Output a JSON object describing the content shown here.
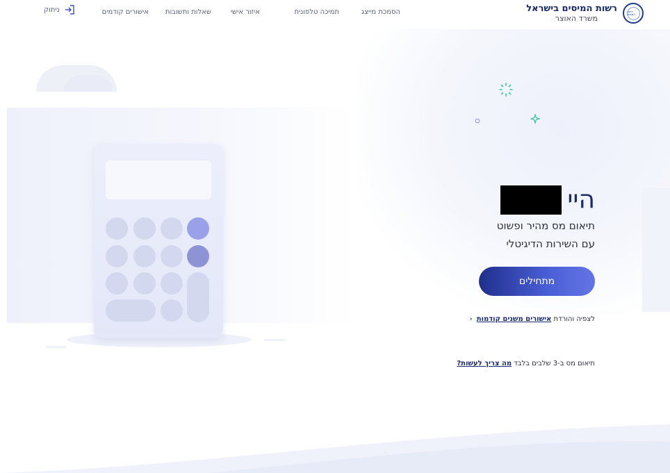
{
  "header": {
    "brand_title": "רשות המיסים בישראל",
    "brand_subtitle": "משרד האוצר",
    "logo_text": "רשות המסים",
    "nav": [
      {
        "label": "הסמכת מייצג"
      },
      {
        "label": "תמיכה טלפונית"
      },
      {
        "label": "איזור אישי"
      },
      {
        "label": "שאלות ותשובות"
      },
      {
        "label": "אישורים קודמים"
      }
    ],
    "logout_label": "ניתוק"
  },
  "hero": {
    "greeting": "היי",
    "lead_line1": "תיאום מס מהיר ופשוט",
    "lead_line2": "עם השירות הדיגיטלי",
    "cta_label": "מתחילים",
    "prev_text": "לצפיה והורדת",
    "prev_link": "אישורים משנים קודמות",
    "steps_text": "תיאום מס ב-3 שלבים בלבד",
    "steps_link": "מה צריך לעשות?"
  },
  "icons": {
    "logout": "logout-arrow-icon",
    "chevron": "chevron-left-icon",
    "illustration": "calculator-illustration"
  },
  "colors": {
    "brand": "#1a2a6c",
    "cta_start": "#1f2f8c",
    "cta_end": "#6474e6",
    "accent_sparkle": "#3fc6a8"
  }
}
